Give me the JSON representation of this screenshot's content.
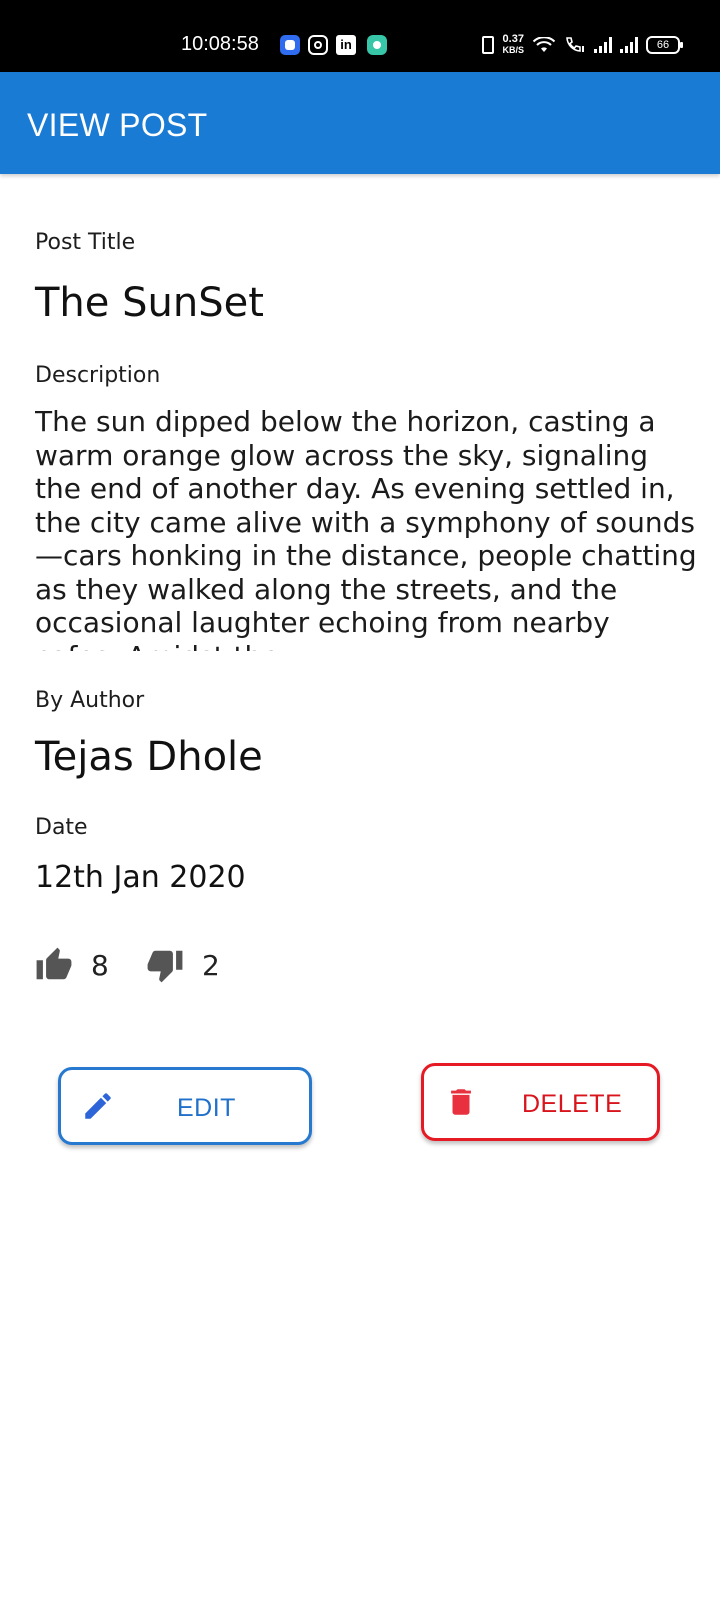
{
  "status_bar": {
    "time": "10:08:58",
    "net_speed_value": "0.37",
    "net_speed_unit": "KB/S",
    "battery": "66",
    "icons": [
      "app-icon",
      "instagram-icon",
      "linkedin-icon",
      "chat-icon",
      "vibrate-icon",
      "wifi-icon",
      "call-icon",
      "signal-icon",
      "signal-icon",
      "battery-icon"
    ]
  },
  "app_bar": {
    "title": "VIEW POST",
    "color": "#1a7bd4"
  },
  "post": {
    "title_label": "Post Title",
    "title": "The SunSet",
    "description_label": "Description",
    "description": "The sun dipped below the horizon, casting a warm orange glow across the sky, signaling the end of another day. As evening settled in, the city came alive with a symphony of sounds—cars honking in the distance, people chatting as they walked along the streets, and the occasional laughter echoing from nearby cafes. Amidst the",
    "author_label": "By Author",
    "author": "Tejas Dhole",
    "date_label": "Date",
    "date": "12th Jan 2020"
  },
  "votes": {
    "likes": "8",
    "dislikes": "2",
    "icon_color": "#555555"
  },
  "actions": {
    "edit_label": "EDIT",
    "delete_label": "DELETE",
    "edit_color": "#2779d0",
    "delete_color": "#e61a24"
  }
}
